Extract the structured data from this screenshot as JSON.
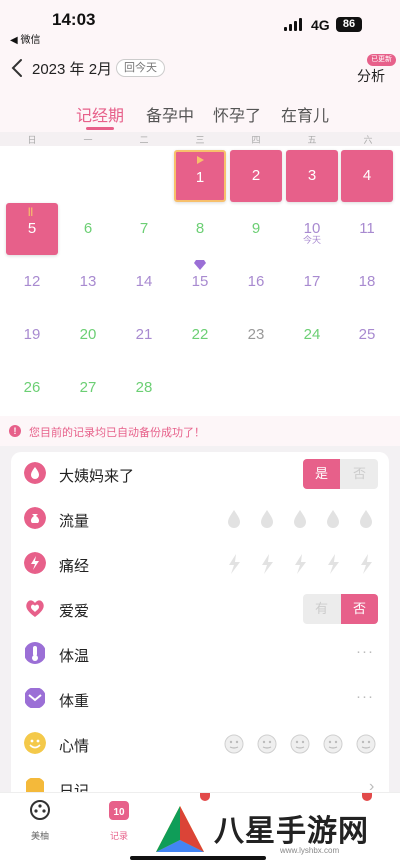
{
  "status_bar": {
    "time": "14:03",
    "back_app": "◀ 微信",
    "network": "4G",
    "battery": "86"
  },
  "header": {
    "month_label": "2023 年 2月",
    "today_button": "回今天",
    "analyze_label": "分析",
    "analyze_badge": "已更新"
  },
  "mode_tabs": [
    {
      "label": "记经期",
      "active": true
    },
    {
      "label": "备孕中",
      "active": false
    },
    {
      "label": "怀孕了",
      "active": false
    },
    {
      "label": "在育儿",
      "active": false
    }
  ],
  "weekdays": [
    "日",
    "一",
    "二",
    "三",
    "四",
    "五",
    "六"
  ],
  "calendar": {
    "days": [
      {
        "n": "1",
        "col": 3,
        "row": 0,
        "style": "period",
        "selected": true,
        "mark": "flag"
      },
      {
        "n": "2",
        "col": 4,
        "row": 0,
        "style": "period"
      },
      {
        "n": "3",
        "col": 5,
        "row": 0,
        "style": "period"
      },
      {
        "n": "4",
        "col": 6,
        "row": 0,
        "style": "period"
      },
      {
        "n": "5",
        "col": 0,
        "row": 1,
        "style": "period",
        "mark": "tally"
      },
      {
        "n": "6",
        "col": 1,
        "row": 1,
        "style": "green"
      },
      {
        "n": "7",
        "col": 2,
        "row": 1,
        "style": "green"
      },
      {
        "n": "8",
        "col": 3,
        "row": 1,
        "style": "green"
      },
      {
        "n": "9",
        "col": 4,
        "row": 1,
        "style": "green"
      },
      {
        "n": "10",
        "col": 5,
        "row": 1,
        "style": "purple",
        "sub": "今天"
      },
      {
        "n": "11",
        "col": 6,
        "row": 1,
        "style": "purple"
      },
      {
        "n": "12",
        "col": 0,
        "row": 2,
        "style": "purple"
      },
      {
        "n": "13",
        "col": 1,
        "row": 2,
        "style": "purple"
      },
      {
        "n": "14",
        "col": 2,
        "row": 2,
        "style": "purple"
      },
      {
        "n": "15",
        "col": 3,
        "row": 2,
        "style": "purple",
        "mark": "gem"
      },
      {
        "n": "16",
        "col": 4,
        "row": 2,
        "style": "purple"
      },
      {
        "n": "17",
        "col": 5,
        "row": 2,
        "style": "purple"
      },
      {
        "n": "18",
        "col": 6,
        "row": 2,
        "style": "purple"
      },
      {
        "n": "19",
        "col": 0,
        "row": 3,
        "style": "purple"
      },
      {
        "n": "20",
        "col": 1,
        "row": 3,
        "style": "green"
      },
      {
        "n": "21",
        "col": 2,
        "row": 3,
        "style": "purple"
      },
      {
        "n": "22",
        "col": 3,
        "row": 3,
        "style": "green"
      },
      {
        "n": "23",
        "col": 4,
        "row": 3,
        "style": "grey"
      },
      {
        "n": "24",
        "col": 5,
        "row": 3,
        "style": "green"
      },
      {
        "n": "25",
        "col": 6,
        "row": 3,
        "style": "purple"
      },
      {
        "n": "26",
        "col": 0,
        "row": 4,
        "style": "green"
      },
      {
        "n": "27",
        "col": 1,
        "row": 4,
        "style": "green"
      },
      {
        "n": "28",
        "col": 2,
        "row": 4,
        "style": "green"
      }
    ]
  },
  "notice": {
    "icon": "!",
    "text": "您目前的记录均已自动备份成功了！"
  },
  "records": [
    {
      "label": "大姨妈来了",
      "icon": "drop-icon",
      "icon_color": "#e7608a",
      "control": "toggle",
      "yes": "是",
      "no": "否",
      "selected": "yes"
    },
    {
      "label": "流量",
      "icon": "bag-icon",
      "icon_color": "#e7608a",
      "control": "drops"
    },
    {
      "label": "痛经",
      "icon": "lightning-icon",
      "icon_color": "#e7608a",
      "control": "bolts"
    },
    {
      "label": "爱爱",
      "icon": "heart-icon",
      "icon_color": "#e7608a",
      "control": "toggle",
      "yes": "有",
      "no": "否",
      "selected": "no"
    },
    {
      "label": "体温",
      "icon": "thermometer-icon",
      "icon_color": "#9b6fd6",
      "control": "dots",
      "value": "···"
    },
    {
      "label": "体重",
      "icon": "scale-icon",
      "icon_color": "#9b6fd6",
      "control": "dots",
      "value": "···"
    },
    {
      "label": "心情",
      "icon": "smile-icon",
      "icon_color": "#f4c94a",
      "control": "faces"
    },
    {
      "label": "日记",
      "icon": "note-icon",
      "icon_color": "#f4b93a",
      "control": "arrow",
      "value": "›"
    }
  ],
  "tabbar": [
    {
      "label": "美柚",
      "icon": "film-reel-icon",
      "active": false
    },
    {
      "label": "记录",
      "icon": "calendar-10-icon",
      "icon_text": "10",
      "active": true
    }
  ],
  "watermark": {
    "brand": "八星手游网",
    "url": "www.lyshbx.com"
  },
  "colors": {
    "accent": "#e7608a",
    "green": "#6ccf74",
    "purple": "#a88ad0"
  }
}
